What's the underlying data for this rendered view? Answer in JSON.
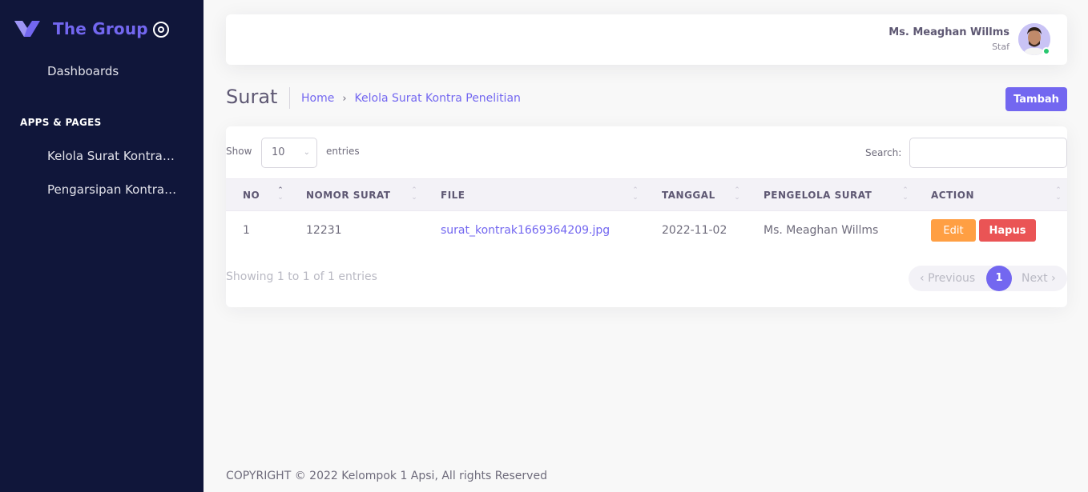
{
  "brand": {
    "name": "The Group",
    "color": "#7367f0"
  },
  "sidebar": {
    "items": [
      {
        "label": "Dashboards"
      },
      {
        "label": "Kelola Surat Kontrak Penelitian"
      },
      {
        "label": "Pengarsipan Kontrak Penelitian"
      }
    ],
    "section_header": "APPS & PAGES"
  },
  "user": {
    "name": "Ms. Meaghan Willms",
    "role": "Staf",
    "status_color": "#28c76f"
  },
  "page": {
    "title": "Surat",
    "breadcrumb": [
      {
        "label": "Home"
      },
      {
        "label": "Kelola Surat Kontra Penelitian"
      }
    ],
    "add_button": "Tambah"
  },
  "table": {
    "show_label": "Show",
    "page_length": "10",
    "entries_label": "entries",
    "search_label": "Search:",
    "search_value": "",
    "columns": [
      "NO",
      "NOMOR SURAT",
      "FILE",
      "TANGGAL",
      "PENGELOLA SURAT",
      "ACTION"
    ],
    "rows": [
      {
        "no": "1",
        "nomor_surat": "12231",
        "file": "surat_kontrak1669364209.jpg",
        "tanggal": "2022-11-02",
        "pengelola": "Ms. Meaghan Willms",
        "edit_label": "Edit",
        "delete_label": "Hapus"
      }
    ],
    "info": "Showing 1 to 1 of 1 entries",
    "pagination": {
      "previous": "Previous",
      "current": "1",
      "next": "Next"
    }
  },
  "footer": {
    "text": "COPYRIGHT © 2022 Kelompok 1 Apsi, All rights Reserved"
  },
  "colors": {
    "primary": "#7367f0",
    "warning": "#ff9f43",
    "danger": "#ea5455",
    "sidebar_bg": "#10163a"
  }
}
